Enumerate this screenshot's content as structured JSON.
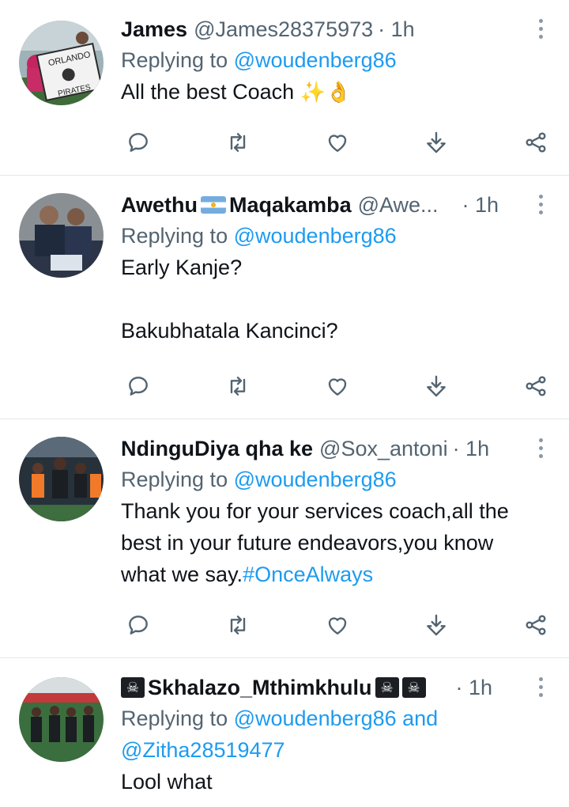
{
  "tweets": [
    {
      "name": "James",
      "handle": "@James28375973",
      "time": "· 1h",
      "replying_prefix": "Replying to ",
      "replying_mention": "@woudenberg86",
      "text_lines": [
        "All the best Coach"
      ],
      "emoji": "✨👌",
      "avatar_text": [
        "ORLANDO",
        "PIRATES"
      ]
    },
    {
      "name_part1": "Awethu",
      "name_part2": "Maqakamba",
      "handle": "@Awe...",
      "time": "· 1h",
      "replying_prefix": "Replying to ",
      "replying_mention": "@woudenberg86",
      "text_lines": [
        "Early Kanje?",
        "",
        "Bakubhatala Kancinci?"
      ]
    },
    {
      "name": "NdinguDiya qha ke",
      "handle": "@Sox_antoni",
      "time": "· 1h",
      "replying_prefix": "Replying to ",
      "replying_mention": "@woudenberg86",
      "text_lines": [
        "Thank you for your services coach,all the",
        "best in your future endeavors,you know",
        "what we say."
      ],
      "hashtag": "#OnceAlways"
    },
    {
      "name": "Skhalazo_Mthimkhulu",
      "time": "· 1h",
      "replying_prefix": "Replying to ",
      "replying_mention": "@woudenberg86 and",
      "replying_mention2": "@Zitha28519477",
      "text_lines": [
        "Lool what"
      ]
    }
  ],
  "actions": {
    "reply_icon": "reply-icon",
    "retweet_icon": "retweet-icon",
    "like_icon": "heart-icon",
    "save_icon": "download-icon",
    "share_icon": "share-icon"
  },
  "colors": {
    "link": "#1d9bf0",
    "secondary": "#536471",
    "text": "#0f1419",
    "divider": "#e3e7ea"
  }
}
